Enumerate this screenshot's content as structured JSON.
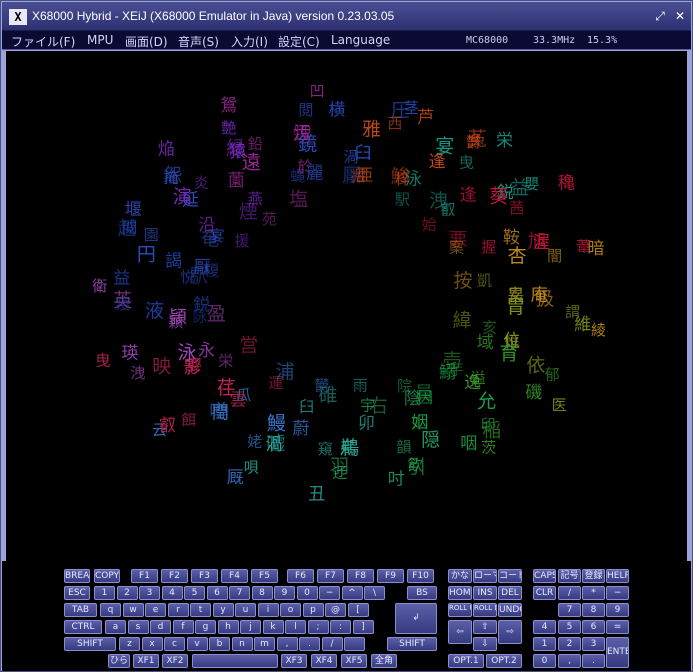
{
  "window": {
    "title": "X68000 Hybrid - XEiJ (X68000 Emulator in Java) version 0.23.03.05",
    "icon": "app-logo-icon",
    "restore_glyph": "⤢",
    "close_glyph": "✕"
  },
  "menu": {
    "items": [
      "ファイル(F)",
      "MPU",
      "画面(D)",
      "音声(S)",
      "入力(I)",
      "設定(C)",
      "Language"
    ],
    "cpu": "MC68000",
    "clock": "33.3MHz",
    "load": "15.3%"
  },
  "screen": {
    "background": "#000000",
    "clusters": [
      {
        "chars": "蝿麗鏡閲横厭渦臼圧茎",
        "color": "#2a4fc8"
      },
      {
        "chars": "摺亜雅西芦鯵梓逢菟欝",
        "color": "#c84a1a"
      },
      {
        "chars": "駅泳宴曳栄洩叡鋭益嬰",
        "color": "#1c9a8a"
      },
      {
        "chars": "姶逢葵茜穐悪握渥旭葦",
        "color": "#c8183a"
      },
      {
        "chars": "案鞍杏闇暗按安庵扱綾",
        "color": "#c8901a"
      },
      {
        "chars": "凱畏胃謂維緯惟位依医",
        "color": "#8a9a1a"
      },
      {
        "chars": "亥域育郁磯壱溢逸稲茨",
        "color": "#3a9a2a"
      },
      {
        "chars": "芋鰯允印咽員因姻引飲",
        "color": "#1aa84a"
      },
      {
        "chars": "院陰隠韻吋右宇烏羽迂",
        "color": "#28a060"
      },
      {
        "chars": "雨卯鵜窺丑碓臼渦嘘唄",
        "color": "#2aa8a0"
      },
      {
        "chars": "欝蔚鰻姥厩浦瓜閏噂云",
        "color": "#3a7ad0"
      },
      {
        "chars": "運雲荏餌叡営嬰影映曳",
        "color": "#c8285a"
      },
      {
        "chars": "栄永泳洩瑛盈穎頴英衛",
        "color": "#a84ac0"
      },
      {
        "chars": "詠鋭液疫益駅悦謁越閲",
        "color": "#2040a8"
      },
      {
        "chars": "榎厭円園堰奄宴延怨掩",
        "color": "#3050c8"
      },
      {
        "chars": "援沿演炎焔煙燕猿縁艶",
        "color": "#7a2ac0"
      },
      {
        "chars": "苑薗遠鉛鴛塩於汚甥凹",
        "color": "#a02a9a"
      }
    ]
  },
  "keyboard": {
    "keys": [
      {
        "name": "break",
        "label": "BREAK"
      },
      {
        "name": "copy",
        "label": "COPY"
      },
      {
        "name": "f1",
        "label": "F1"
      },
      {
        "name": "f2",
        "label": "F2"
      },
      {
        "name": "f3",
        "label": "F3"
      },
      {
        "name": "f4",
        "label": "F4"
      },
      {
        "name": "f5",
        "label": "F5"
      },
      {
        "name": "f6",
        "label": "F6"
      },
      {
        "name": "f7",
        "label": "F7"
      },
      {
        "name": "f8",
        "label": "F8"
      },
      {
        "name": "f9",
        "label": "F9"
      },
      {
        "name": "f10",
        "label": "F10"
      },
      {
        "name": "kana",
        "label": "かな"
      },
      {
        "name": "romaji",
        "label": "ローマ"
      },
      {
        "name": "code",
        "label": "コード"
      },
      {
        "name": "caps",
        "label": "CAPS"
      },
      {
        "name": "kigou",
        "label": "記号"
      },
      {
        "name": "touroku",
        "label": "登録"
      },
      {
        "name": "help",
        "label": "HELP"
      },
      {
        "name": "esc",
        "label": "ESC"
      },
      {
        "name": "1",
        "label": "1"
      },
      {
        "name": "2",
        "label": "2"
      },
      {
        "name": "3",
        "label": "3"
      },
      {
        "name": "4",
        "label": "4"
      },
      {
        "name": "5",
        "label": "5"
      },
      {
        "name": "6",
        "label": "6"
      },
      {
        "name": "7",
        "label": "7"
      },
      {
        "name": "8",
        "label": "8"
      },
      {
        "name": "9",
        "label": "9"
      },
      {
        "name": "0",
        "label": "0"
      },
      {
        "name": "minus",
        "label": "−"
      },
      {
        "name": "caret",
        "label": "^"
      },
      {
        "name": "yen",
        "label": "\\"
      },
      {
        "name": "bs",
        "label": "BS"
      },
      {
        "name": "home",
        "label": "HOME"
      },
      {
        "name": "ins",
        "label": "INS"
      },
      {
        "name": "del",
        "label": "DEL"
      },
      {
        "name": "clr",
        "label": "CLR"
      },
      {
        "name": "kp-slash",
        "label": "/"
      },
      {
        "name": "kp-star",
        "label": "*"
      },
      {
        "name": "kp-minus",
        "label": "−"
      },
      {
        "name": "tab",
        "label": "TAB"
      },
      {
        "name": "q",
        "label": "q"
      },
      {
        "name": "w",
        "label": "w"
      },
      {
        "name": "e",
        "label": "e"
      },
      {
        "name": "r",
        "label": "r"
      },
      {
        "name": "t",
        "label": "t"
      },
      {
        "name": "y",
        "label": "y"
      },
      {
        "name": "u",
        "label": "u"
      },
      {
        "name": "i",
        "label": "i"
      },
      {
        "name": "o",
        "label": "o"
      },
      {
        "name": "p",
        "label": "p"
      },
      {
        "name": "at",
        "label": "@"
      },
      {
        "name": "lbracket",
        "label": "["
      },
      {
        "name": "return",
        "label": "↲"
      },
      {
        "name": "rollup",
        "label": "ROLL UP"
      },
      {
        "name": "rolldown",
        "label": "ROLL DOWN"
      },
      {
        "name": "undo",
        "label": "UNDO"
      },
      {
        "name": "kp7",
        "label": "7"
      },
      {
        "name": "kp8",
        "label": "8"
      },
      {
        "name": "kp9",
        "label": "9"
      },
      {
        "name": "kp-plus",
        "label": "+"
      },
      {
        "name": "ctrl",
        "label": "CTRL"
      },
      {
        "name": "a",
        "label": "a"
      },
      {
        "name": "s",
        "label": "s"
      },
      {
        "name": "d",
        "label": "d"
      },
      {
        "name": "f",
        "label": "f"
      },
      {
        "name": "g",
        "label": "g"
      },
      {
        "name": "h",
        "label": "h"
      },
      {
        "name": "j",
        "label": "j"
      },
      {
        "name": "k",
        "label": "k"
      },
      {
        "name": "l",
        "label": "l"
      },
      {
        "name": "semicolon",
        "label": ";"
      },
      {
        "name": "colon",
        "label": ":"
      },
      {
        "name": "rbracket",
        "label": "]"
      },
      {
        "name": "left",
        "label": "⇦"
      },
      {
        "name": "up",
        "label": "⇧"
      },
      {
        "name": "right",
        "label": "⇨"
      },
      {
        "name": "kp4",
        "label": "4"
      },
      {
        "name": "kp5",
        "label": "5"
      },
      {
        "name": "kp6",
        "label": "6"
      },
      {
        "name": "kp-equal",
        "label": "="
      },
      {
        "name": "shift-l",
        "label": "SHIFT"
      },
      {
        "name": "z",
        "label": "z"
      },
      {
        "name": "x",
        "label": "x"
      },
      {
        "name": "c",
        "label": "c"
      },
      {
        "name": "v",
        "label": "v"
      },
      {
        "name": "b",
        "label": "b"
      },
      {
        "name": "n",
        "label": "n"
      },
      {
        "name": "m",
        "label": "m"
      },
      {
        "name": "comma",
        "label": ","
      },
      {
        "name": "period",
        "label": "."
      },
      {
        "name": "slash",
        "label": "/"
      },
      {
        "name": "underscore",
        "label": " "
      },
      {
        "name": "shift-r",
        "label": "SHIFT"
      },
      {
        "name": "down",
        "label": "⇩"
      },
      {
        "name": "kp1",
        "label": "1"
      },
      {
        "name": "kp2",
        "label": "2"
      },
      {
        "name": "kp3",
        "label": "3"
      },
      {
        "name": "enter",
        "label": "ENTER"
      },
      {
        "name": "hira",
        "label": "ひら"
      },
      {
        "name": "xf1",
        "label": "XF1"
      },
      {
        "name": "xf2",
        "label": "XF2"
      },
      {
        "name": "space",
        "label": ""
      },
      {
        "name": "xf3",
        "label": "XF3"
      },
      {
        "name": "xf4",
        "label": "XF4"
      },
      {
        "name": "xf5",
        "label": "XF5"
      },
      {
        "name": "zenkaku",
        "label": "全角"
      },
      {
        "name": "opt1",
        "label": "OPT.1"
      },
      {
        "name": "opt2",
        "label": "OPT.2"
      },
      {
        "name": "kp0",
        "label": "0"
      },
      {
        "name": "kp-comma",
        "label": ","
      },
      {
        "name": "kp-dot",
        "label": "."
      }
    ]
  }
}
